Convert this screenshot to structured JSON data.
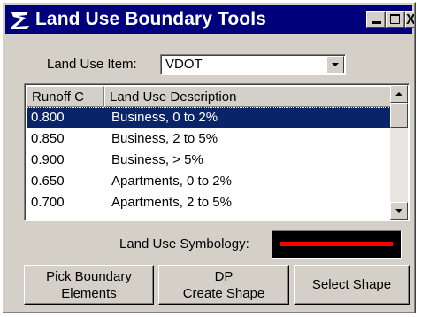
{
  "window": {
    "title": "Land Use Boundary Tools",
    "title_bar_color": "#00007c",
    "icons": [
      "app-logo-icon",
      "minimize-icon",
      "maximize-icon",
      "close-icon"
    ],
    "close_glyph": "X"
  },
  "land_use_item": {
    "label": "Land Use Item:",
    "value": "VDOT"
  },
  "table": {
    "columns": [
      "Runoff C",
      "Land Use Description"
    ],
    "rows": [
      {
        "runoff": "0.800",
        "description": "Business, 0 to 2%",
        "selected": true
      },
      {
        "runoff": "0.850",
        "description": "Business, 2 to 5%",
        "selected": false
      },
      {
        "runoff": "0.900",
        "description": "Business, > 5%",
        "selected": false
      },
      {
        "runoff": "0.650",
        "description": "Apartments, 0 to 2%",
        "selected": false
      },
      {
        "runoff": "0.700",
        "description": "Apartments, 2 to 5%",
        "selected": false
      }
    ],
    "selection_color": "#0a246a"
  },
  "symbology": {
    "label": "Land Use Symbology:",
    "line_color": "#ff0000",
    "background_color": "#000000"
  },
  "buttons": {
    "pick_boundary": [
      "Pick Boundary",
      "Elements"
    ],
    "create_shape": [
      "DP",
      "Create Shape"
    ],
    "select_shape": "Select Shape"
  }
}
